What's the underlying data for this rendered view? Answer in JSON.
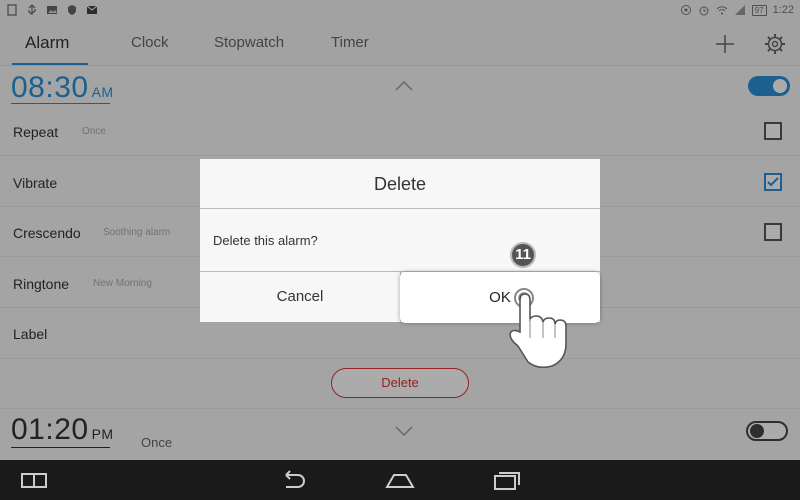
{
  "status_bar": {
    "time": "1:22",
    "battery": "97"
  },
  "tabs": [
    {
      "label": "Alarm",
      "active": true
    },
    {
      "label": "Clock",
      "active": false
    },
    {
      "label": "Stopwatch",
      "active": false
    },
    {
      "label": "Timer",
      "active": false
    }
  ],
  "alarm1": {
    "time": "08:30",
    "ampm": "AM",
    "enabled": true,
    "rows": {
      "repeat": {
        "label": "Repeat",
        "value": "Once",
        "checked": false
      },
      "vibrate": {
        "label": "Vibrate",
        "checked": true
      },
      "crescendo": {
        "label": "Crescendo",
        "value": "Soothing alarm",
        "checked": false
      },
      "ringtone": {
        "label": "Ringtone",
        "value": "New Morning"
      },
      "label": {
        "label": "Label"
      }
    },
    "delete_label": "Delete"
  },
  "alarm2": {
    "time": "01:20",
    "ampm": "PM",
    "repeat": "Once",
    "enabled": false
  },
  "dialog": {
    "title": "Delete",
    "message": "Delete this alarm?",
    "cancel": "Cancel",
    "ok": "OK"
  },
  "step_badge": "11",
  "colors": {
    "accent": "#2a8fd6",
    "danger": "#dd3333"
  }
}
